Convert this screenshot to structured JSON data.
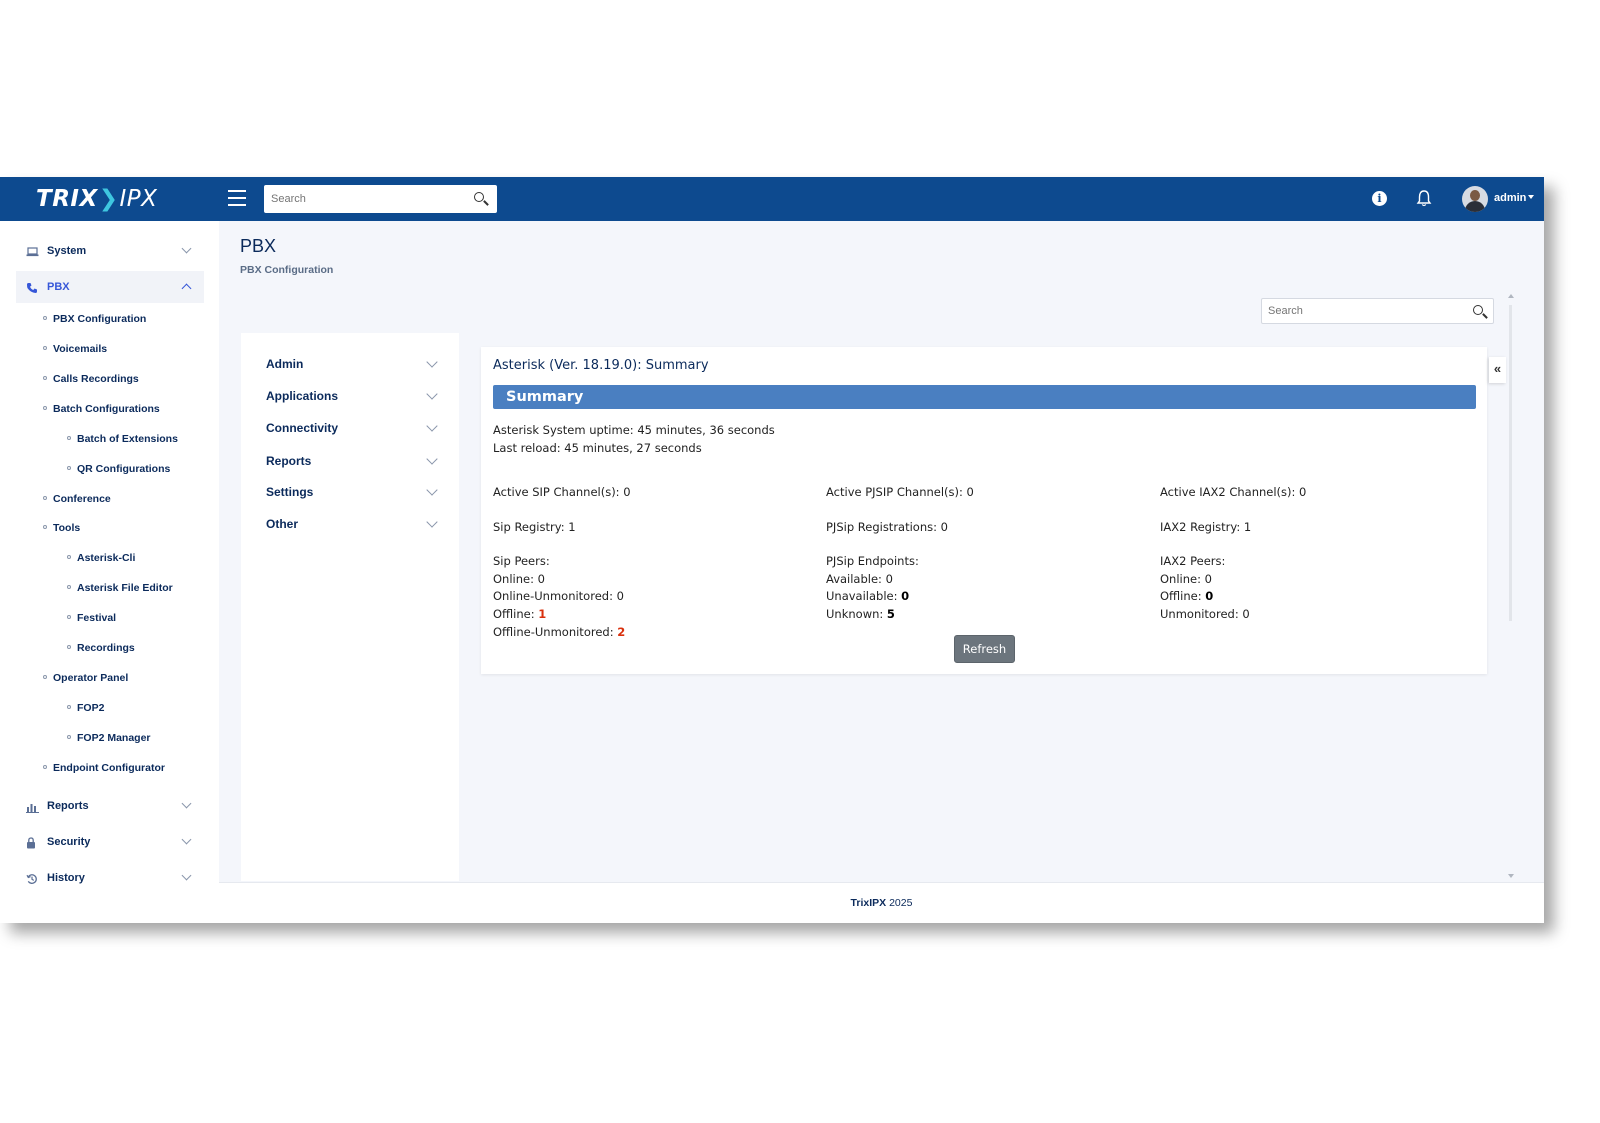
{
  "brand": {
    "part1": "TRIX",
    "part2": "IPX"
  },
  "top_search": {
    "placeholder": "Search"
  },
  "user": {
    "name": "admin"
  },
  "sidebar": {
    "system": "System",
    "pbx": "PBX",
    "pbx_children": {
      "pbx_configuration": "PBX Configuration",
      "voicemails": "Voicemails",
      "calls_recordings": "Calls Recordings",
      "batch_configurations": "Batch Configurations",
      "batch_of_extensions": "Batch of Extensions",
      "qr_configurations": "QR Configurations",
      "conference": "Conference",
      "tools": "Tools",
      "asterisk_cli": "Asterisk-Cli",
      "asterisk_file_editor": "Asterisk File Editor",
      "festival": "Festival",
      "recordings": "Recordings",
      "operator_panel": "Operator Panel",
      "fop2": "FOP2",
      "fop2_manager": "FOP2 Manager",
      "endpoint_configurator": "Endpoint Configurator"
    },
    "reports": "Reports",
    "security": "Security",
    "history": "History"
  },
  "page": {
    "title": "PBX",
    "subtitle": "PBX Configuration"
  },
  "content_search": {
    "placeholder": "Search"
  },
  "menu": {
    "admin": "Admin",
    "applications": "Applications",
    "connectivity": "Connectivity",
    "reports": "Reports",
    "settings": "Settings",
    "other": "Other"
  },
  "card": {
    "title": "Asterisk (Ver. 18.19.0): Summary",
    "summary_label": "Summary",
    "uptime_label": "Asterisk System uptime:",
    "uptime_value": "45 minutes, 36 seconds",
    "reload_label": "Last reload:",
    "reload_value": "45 minutes, 27 seconds",
    "sip_channels_label": "Active SIP Channel(s):",
    "sip_channels_value": "0",
    "pjsip_channels_label": "Active PJSIP Channel(s):",
    "pjsip_channels_value": "0",
    "iax2_channels_label": "Active IAX2 Channel(s):",
    "iax2_channels_value": "0",
    "sip_registry_label": "Sip Registry:",
    "sip_registry_value": "1",
    "pjsip_registrations_label": "PJSip Registrations:",
    "pjsip_registrations_value": "0",
    "iax2_registry_label": "IAX2 Registry:",
    "iax2_registry_value": "1",
    "sip_peers": {
      "heading": "Sip Peers:",
      "online_label": "Online:",
      "online_value": "0",
      "online_unmonitored_label": "Online-Unmonitored:",
      "online_unmonitored_value": "0",
      "offline_label": "Offline:",
      "offline_value": "1",
      "offline_unmonitored_label": "Offline-Unmonitored:",
      "offline_unmonitored_value": "2"
    },
    "pjsip_endpoints": {
      "heading": "PJSip Endpoints:",
      "available_label": "Available:",
      "available_value": "0",
      "unavailable_label": "Unavailable:",
      "unavailable_value": "0",
      "unknown_label": "Unknown:",
      "unknown_value": "5"
    },
    "iax2_peers": {
      "heading": "IAX2 Peers:",
      "online_label": "Online:",
      "online_value": "0",
      "offline_label": "Offline:",
      "offline_value": "0",
      "unmonitored_label": "Unmonitored:",
      "unmonitored_value": "0"
    },
    "refresh_label": "Refresh",
    "collapse_label": "«"
  },
  "footer": {
    "brand": "TrixIPX",
    "year": "2025"
  },
  "colors": {
    "navbar": "#0d4a8f",
    "summary_bar": "#4a7fc1",
    "accent": "#3757d8",
    "alert_red": "#d9300d"
  }
}
